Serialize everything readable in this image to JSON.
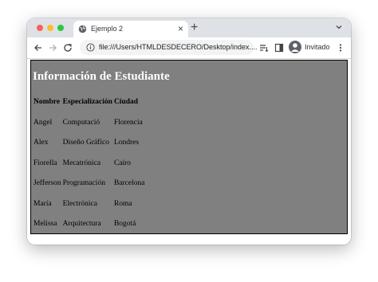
{
  "browser": {
    "tab_title": "Ejemplo 2",
    "tab_close": "×",
    "new_tab": "+",
    "url": "file:///Users/HTMLDESDECERO/Desktop/index....",
    "profile_label": "Invitado",
    "icons": {
      "back": "arrow-left-icon",
      "forward": "arrow-right-icon",
      "reload": "reload-icon",
      "info": "page-info-icon",
      "reading_list": "reading-list-icon",
      "side_panel": "side-panel-icon",
      "menu": "more-vert-icon",
      "tab_search": "chevron-down-icon"
    }
  },
  "page": {
    "heading": "Información de Estudiante",
    "background": "#808080",
    "table": {
      "headers": [
        "Nombre",
        "Especialización",
        "Ciudad"
      ],
      "rows": [
        [
          "Angel",
          "Computació",
          "Florencia"
        ],
        [
          "Alex",
          "Diseño Gráfico",
          "Londres"
        ],
        [
          "Fiorella",
          "Mecatrónica",
          "Cairo"
        ],
        [
          "Jefferson",
          "Programación",
          "Barcelona"
        ],
        [
          "María",
          "Electrónica",
          "Roma"
        ],
        [
          "Melissa",
          "Arquitectura",
          "Bogotá"
        ]
      ]
    }
  }
}
